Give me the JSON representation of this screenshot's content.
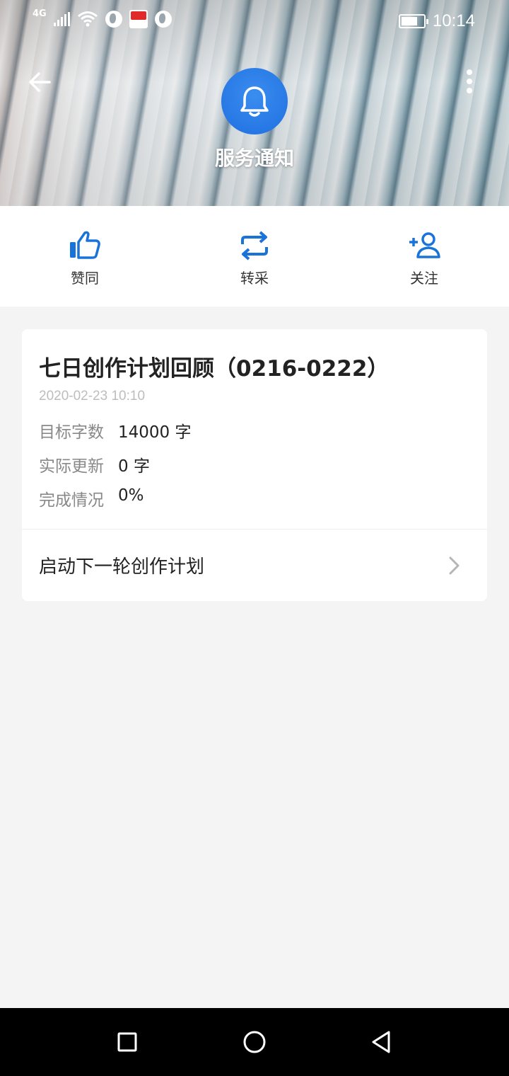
{
  "status_bar": {
    "network": "4G",
    "time": "10:14",
    "icons": [
      "signal-icon",
      "wifi-icon",
      "globe-icon",
      "news-app-icon",
      "globe-icon",
      "battery-icon"
    ]
  },
  "header": {
    "title": "服务通知",
    "back_icon": "arrow-left-icon",
    "more_icon": "more-vertical-icon",
    "avatar_icon": "bell-icon"
  },
  "actions": [
    {
      "label": "赞同",
      "icon": "thumbs-up-icon"
    },
    {
      "label": "转采",
      "icon": "repost-icon"
    },
    {
      "label": "关注",
      "icon": "add-user-icon"
    }
  ],
  "card": {
    "title": "七日创作计划回顾（0216-0222）",
    "timestamp": "2020-02-23 10:10",
    "rows": [
      {
        "key": "目标字数",
        "value": "14000 字"
      },
      {
        "key": "实际更新",
        "value": "0 字"
      },
      {
        "key": "完成情况",
        "value": "0%"
      }
    ],
    "link_label": "启动下一轮创作计划"
  },
  "colors": {
    "accent": "#1f6fe0",
    "icon_blue": "#1a73d9",
    "background": "#f4f4f4"
  }
}
